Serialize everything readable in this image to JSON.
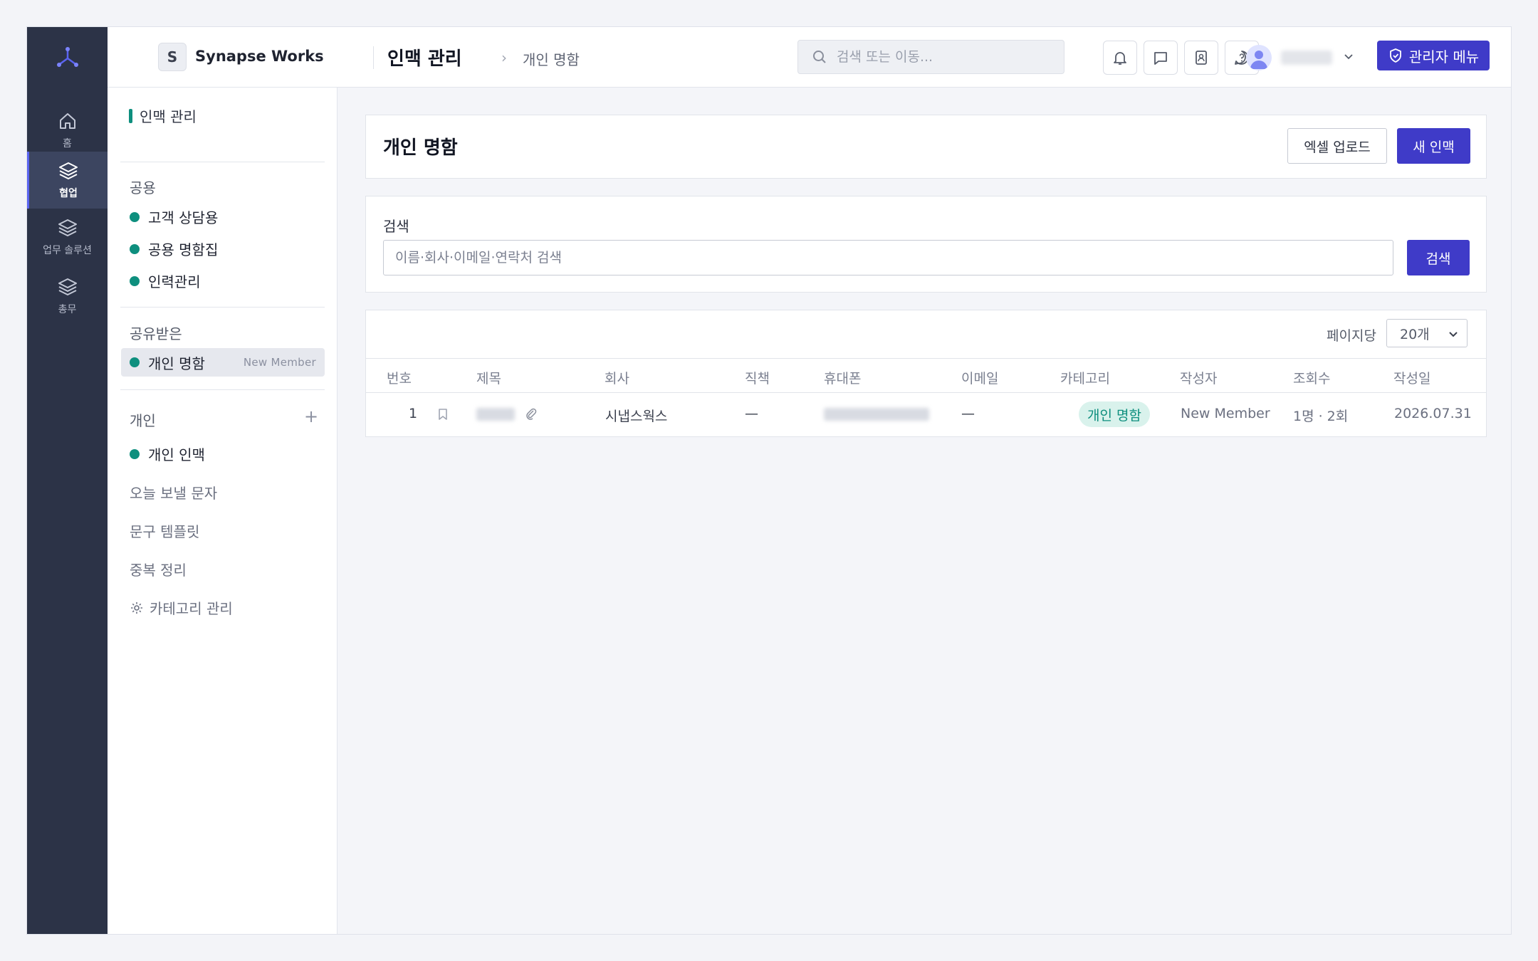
{
  "rail": {
    "items": [
      {
        "label": "홈"
      },
      {
        "label": "협업"
      },
      {
        "label": "업무 솔루션"
      },
      {
        "label": "총무"
      }
    ]
  },
  "header": {
    "org_initial": "S",
    "org_name": "Synapse Works",
    "title": "인맥 관리",
    "breadcrumb": "개인 명함",
    "search_placeholder": "검색 또는 이동...",
    "admin_label": "관리자 메뉴"
  },
  "sidebar": {
    "heading": "인맥 관리",
    "groups": {
      "shared": "공용",
      "received": "공유받은",
      "personal": "개인"
    },
    "shared_items": [
      "고객 상담용",
      "공용 명함집",
      "인력관리"
    ],
    "received_item": {
      "label": "개인 명함",
      "meta": "New Member"
    },
    "personal_items": [
      "개인 인맥"
    ],
    "links": [
      "오늘 보낼 문자",
      "문구 템플릿",
      "중복 정리",
      "카테고리 관리"
    ],
    "add_symbol": "+"
  },
  "page": {
    "title": "개인 명함",
    "excel_upload": "엑셀 업로드",
    "new_contact": "새 인맥"
  },
  "search": {
    "label": "검색",
    "placeholder": "이름·회사·이메일·연락처 검색",
    "button": "검색"
  },
  "table": {
    "per_page_label": "페이지당",
    "per_page_value": "20개",
    "columns": [
      "번호",
      "제목",
      "회사",
      "직책",
      "휴대폰",
      "이메일",
      "카테고리",
      "작성자",
      "조회수",
      "작성일"
    ],
    "rows": [
      {
        "no": "1",
        "company": "시냅스웍스",
        "position": "—",
        "email": "—",
        "category": "개인 명함",
        "author": "New Member",
        "views": "1명 · 2회",
        "date": "2026.07.31"
      }
    ]
  },
  "colors": {
    "rail_bg": "#2c3347",
    "primary": "#3f3bc8",
    "accent_green": "#0e8f7e"
  }
}
